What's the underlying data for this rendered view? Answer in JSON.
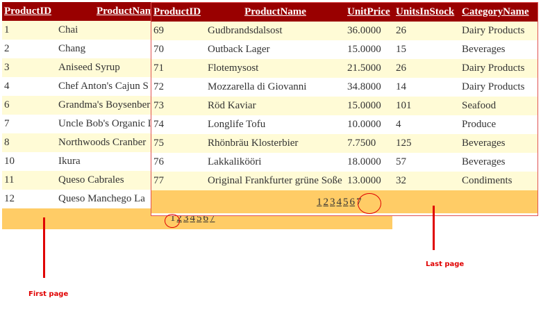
{
  "first_grid": {
    "headers": [
      "ProductID",
      "ProductName"
    ],
    "rows": [
      [
        "1",
        "Chai"
      ],
      [
        "2",
        "Chang"
      ],
      [
        "3",
        "Aniseed Syrup"
      ],
      [
        "4",
        "Chef Anton's Cajun S"
      ],
      [
        "6",
        "Grandma's Boysenber"
      ],
      [
        "7",
        "Uncle Bob's Organic I"
      ],
      [
        "8",
        "Northwoods Cranber"
      ],
      [
        "10",
        "Ikura"
      ],
      [
        "11",
        "Queso Cabrales"
      ],
      [
        "12",
        "Queso Manchego La"
      ]
    ],
    "pager": {
      "current": "1",
      "links": [
        "2",
        "3",
        "4",
        "5",
        "6",
        "7"
      ]
    }
  },
  "last_grid": {
    "headers": [
      "ProductID",
      "ProductName",
      "UnitPrice",
      "UnitsInStock",
      "CategoryName"
    ],
    "rows": [
      [
        "69",
        "Gudbrandsdalsost",
        "36.0000",
        "26",
        "Dairy Products"
      ],
      [
        "70",
        "Outback Lager",
        "15.0000",
        "15",
        "Beverages"
      ],
      [
        "71",
        "Flotemysost",
        "21.5000",
        "26",
        "Dairy Products"
      ],
      [
        "72",
        "Mozzarella di Giovanni",
        "34.8000",
        "14",
        "Dairy Products"
      ],
      [
        "73",
        "Röd Kaviar",
        "15.0000",
        "101",
        "Seafood"
      ],
      [
        "74",
        "Longlife Tofu",
        "10.0000",
        "4",
        "Produce"
      ],
      [
        "75",
        "Rhönbräu Klosterbier",
        "7.7500",
        "125",
        "Beverages"
      ],
      [
        "76",
        "Lakkalikööri",
        "18.0000",
        "57",
        "Beverages"
      ],
      [
        "77",
        "Original Frankfurter grüne Soße",
        "13.0000",
        "32",
        "Condiments"
      ]
    ],
    "pager": {
      "links": [
        "1",
        "2",
        "3",
        "4",
        "5",
        "6"
      ],
      "current": "7"
    }
  },
  "annotations": {
    "first_page": "First page",
    "last_page": "Last page",
    "color": "#e00000"
  },
  "colors": {
    "header_bg": "#990000",
    "pager_bg": "#ffcc66",
    "odd_row_bg": "#fffbd6"
  }
}
